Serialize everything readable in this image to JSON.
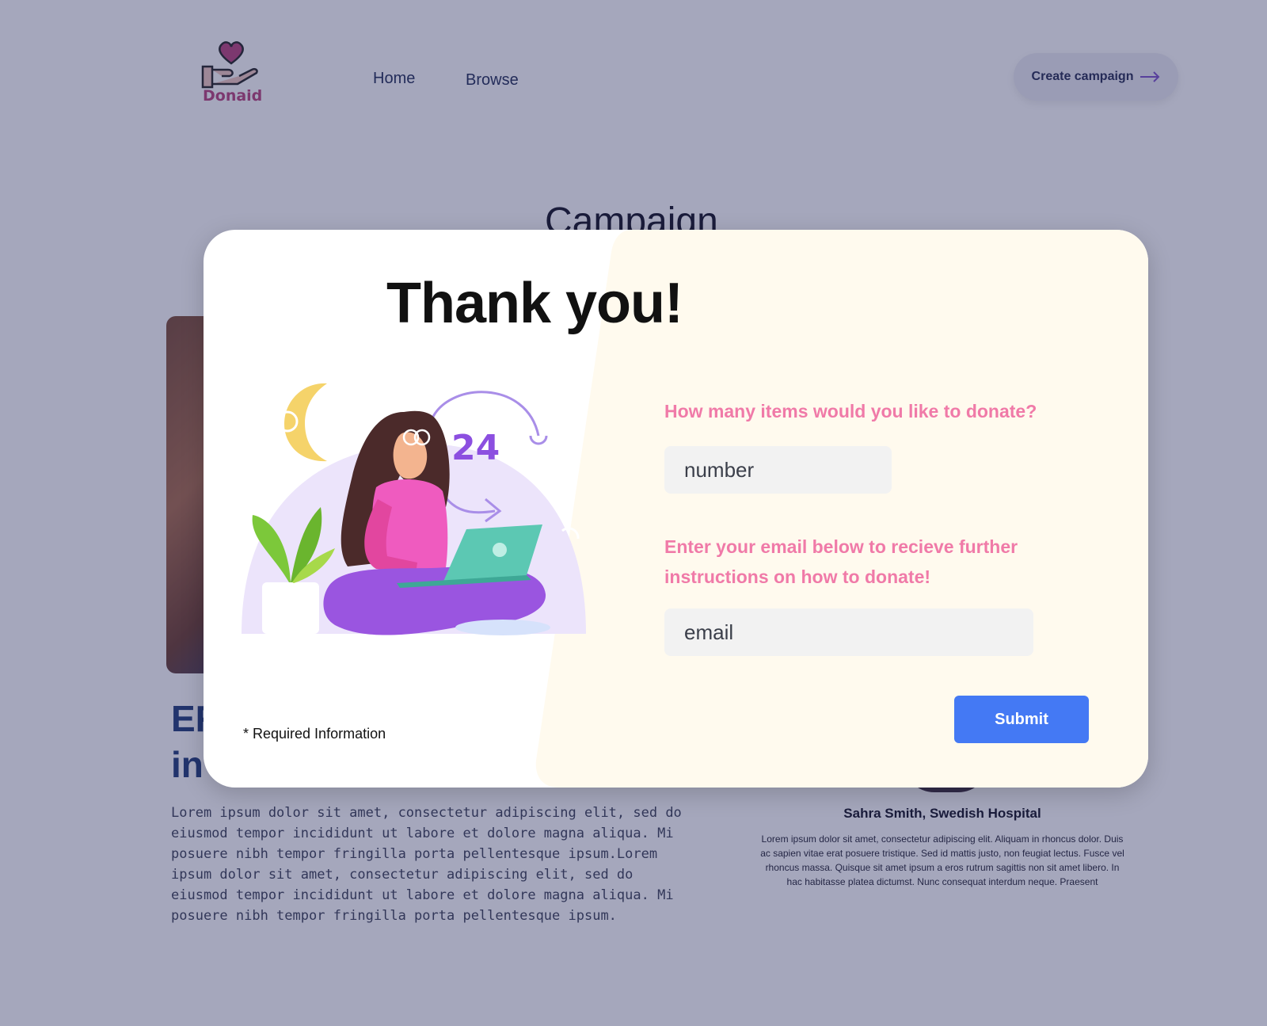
{
  "header": {
    "logo_text": "Donaid",
    "nav": {
      "home": "Home",
      "browse": "Browse"
    },
    "create_button": "Create campaign"
  },
  "background": {
    "section_heading": "Campaign",
    "campaign_title": "ER\nin",
    "campaign_body": "Lorem ipsum dolor sit amet, consectetur adipiscing elit, sed do eiusmod tempor incididunt ut labore et dolore magna aliqua. Mi posuere nibh tempor fringilla porta pellentesque ipsum.Lorem ipsum dolor sit amet, consectetur adipiscing elit, sed do eiusmod tempor incididunt ut labore et dolore magna aliqua. Mi posuere nibh tempor fringilla porta pellentesque ipsum.",
    "testimonial_name": "Sahra Smith, Swedish Hospital",
    "testimonial_text": "Lorem ipsum dolor sit amet, consectetur adipiscing elit. Aliquam in rhoncus dolor. Duis ac sapien vitae erat posuere tristique. Sed id mattis justo, non feugiat lectus. Fusce vel rhoncus massa. Quisque sit amet ipsum a eros rutrum sagittis non sit amet libero. In hac habitasse platea dictumst. Nunc consequat interdum neque. Praesent"
  },
  "modal": {
    "title": "Thank you!",
    "illustration_number": "24",
    "question_items": "How many items would you like to donate?",
    "number_placeholder": "number",
    "question_email": "Enter your email below to recieve further instructions on how to donate!",
    "email_placeholder": "email",
    "required_note": "* Required Information",
    "submit_label": "Submit"
  },
  "colors": {
    "accent_pink": "#f07aa8",
    "submit_blue": "#4479f4",
    "modal_tint": "#fffaee",
    "overlay": "rgba(40,45,95,0.42)",
    "brand_pink": "#b8407a"
  },
  "icons": [
    "heart-hand-icon",
    "arrow-right-icon"
  ]
}
